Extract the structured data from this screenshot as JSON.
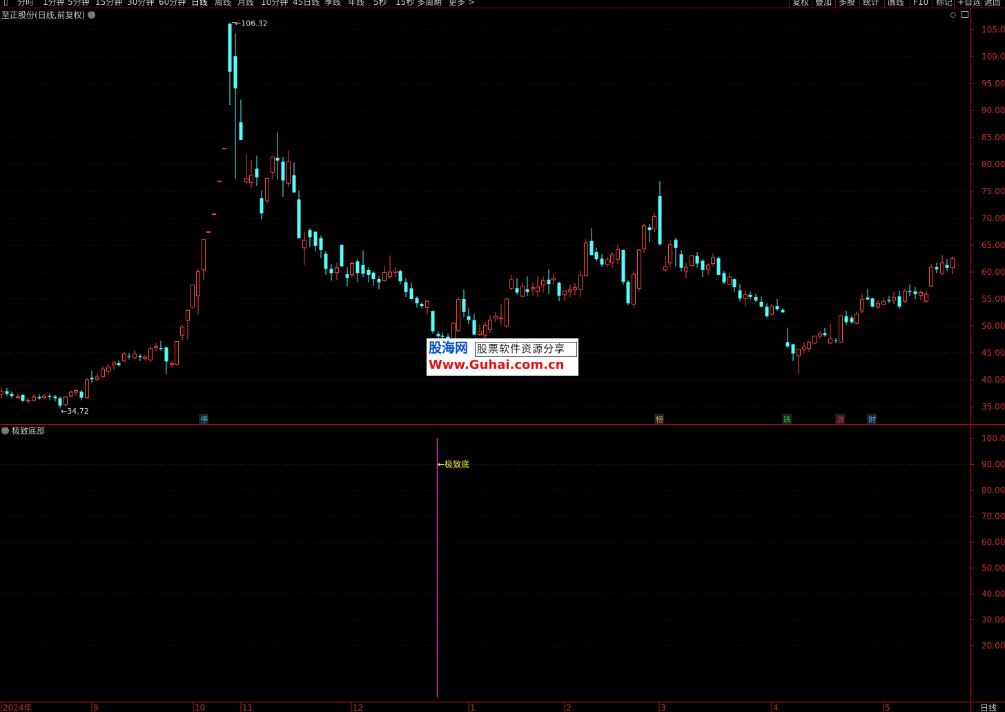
{
  "toolbar": {
    "left_items": [
      "分时",
      "1分钟",
      "5分钟",
      "15分钟",
      "30分钟",
      "60分钟",
      "日线",
      "周线",
      "月线",
      "10分钟",
      "45日线",
      "季线",
      "年线",
      "5秒",
      "15秒",
      "多周期",
      "更多 >"
    ],
    "active_item": "日线",
    "right_items": [
      "复权",
      "叠加",
      "多股",
      "统计",
      "画线",
      "F10",
      "标记",
      "+自选",
      "返回"
    ]
  },
  "main_panel": {
    "title": "至正股份(日线,前复权)",
    "max_label": "106.32",
    "min_label": "34.72",
    "yaxis": [
      "105.00",
      "100.00",
      "95.00",
      "90.00",
      "85.00",
      "80.00",
      "75.00",
      "70.00",
      "65.00",
      "60.00",
      "55.00",
      "50.00",
      "45.00",
      "40.00",
      "35.00"
    ]
  },
  "markers": [
    {
      "text": "停",
      "color": "#40c0c0"
    },
    {
      "text": "榜",
      "color": "#e0a040"
    },
    {
      "text": "跌",
      "color": "#30c030"
    },
    {
      "text": "涨",
      "color": "#ff4040"
    },
    {
      "text": "财",
      "color": "#60a0ff"
    }
  ],
  "indicator_panel": {
    "title": "极致底部",
    "signal_label": "←极致底",
    "yaxis": [
      "100.00",
      "90.00",
      "80.00",
      "70.00",
      "60.00",
      "50.00",
      "40.00",
      "30.00",
      "20.00"
    ]
  },
  "time_axis": [
    "2024年",
    "9",
    "10",
    "11",
    "12",
    "1",
    "2",
    "3",
    "4",
    "5"
  ],
  "period_label": "日线",
  "watermark": {
    "site_name": "股海网",
    "slogan": "股票软件资源分享",
    "url": "Www.Guhai.com.cn"
  },
  "colors": {
    "up": "#ff4444",
    "down": "#54fcfc",
    "grid": "#6a1010",
    "border": "#b01818",
    "signal": "#c040c0",
    "signal_label": "#ffff40"
  }
}
